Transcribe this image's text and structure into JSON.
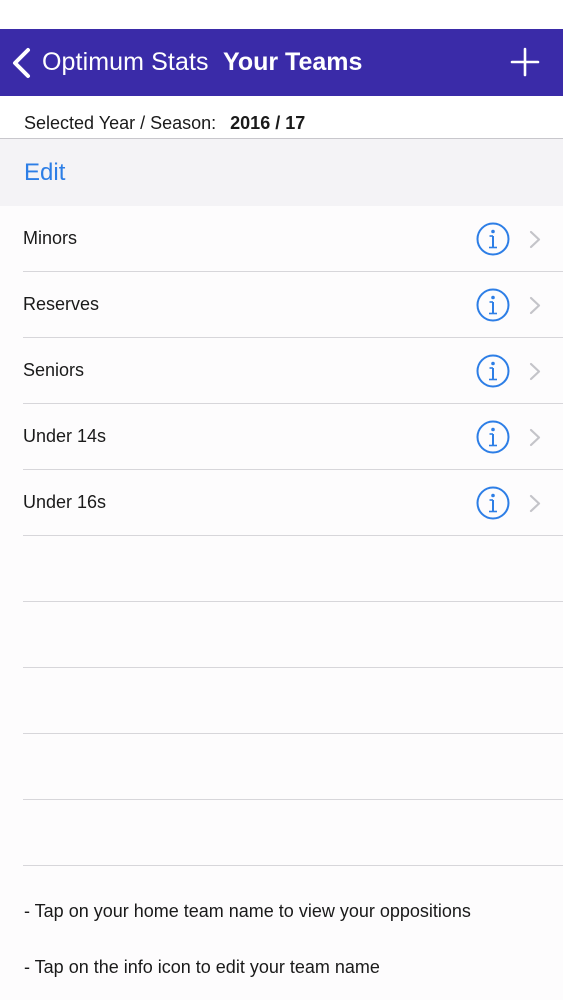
{
  "nav": {
    "back_label": "Optimum Stats",
    "title": "Your Teams",
    "add_icon": "plus-icon",
    "back_icon": "chevron-left-icon"
  },
  "season": {
    "label": "Selected Year / Season:",
    "value": "2016 / 17"
  },
  "edit_label": "Edit",
  "teams": [
    {
      "name": "Minors"
    },
    {
      "name": "Reserves"
    },
    {
      "name": "Seniors"
    },
    {
      "name": "Under 14s"
    },
    {
      "name": "Under 16s"
    }
  ],
  "help": {
    "line1": "- Tap on your home team name to view your oppositions",
    "line2": "- Tap on the info icon to edit your team name"
  },
  "colors": {
    "nav_background": "#3a2ba8",
    "accent_blue": "#2d7ee6",
    "chevron_gray": "#c4c4c9"
  }
}
